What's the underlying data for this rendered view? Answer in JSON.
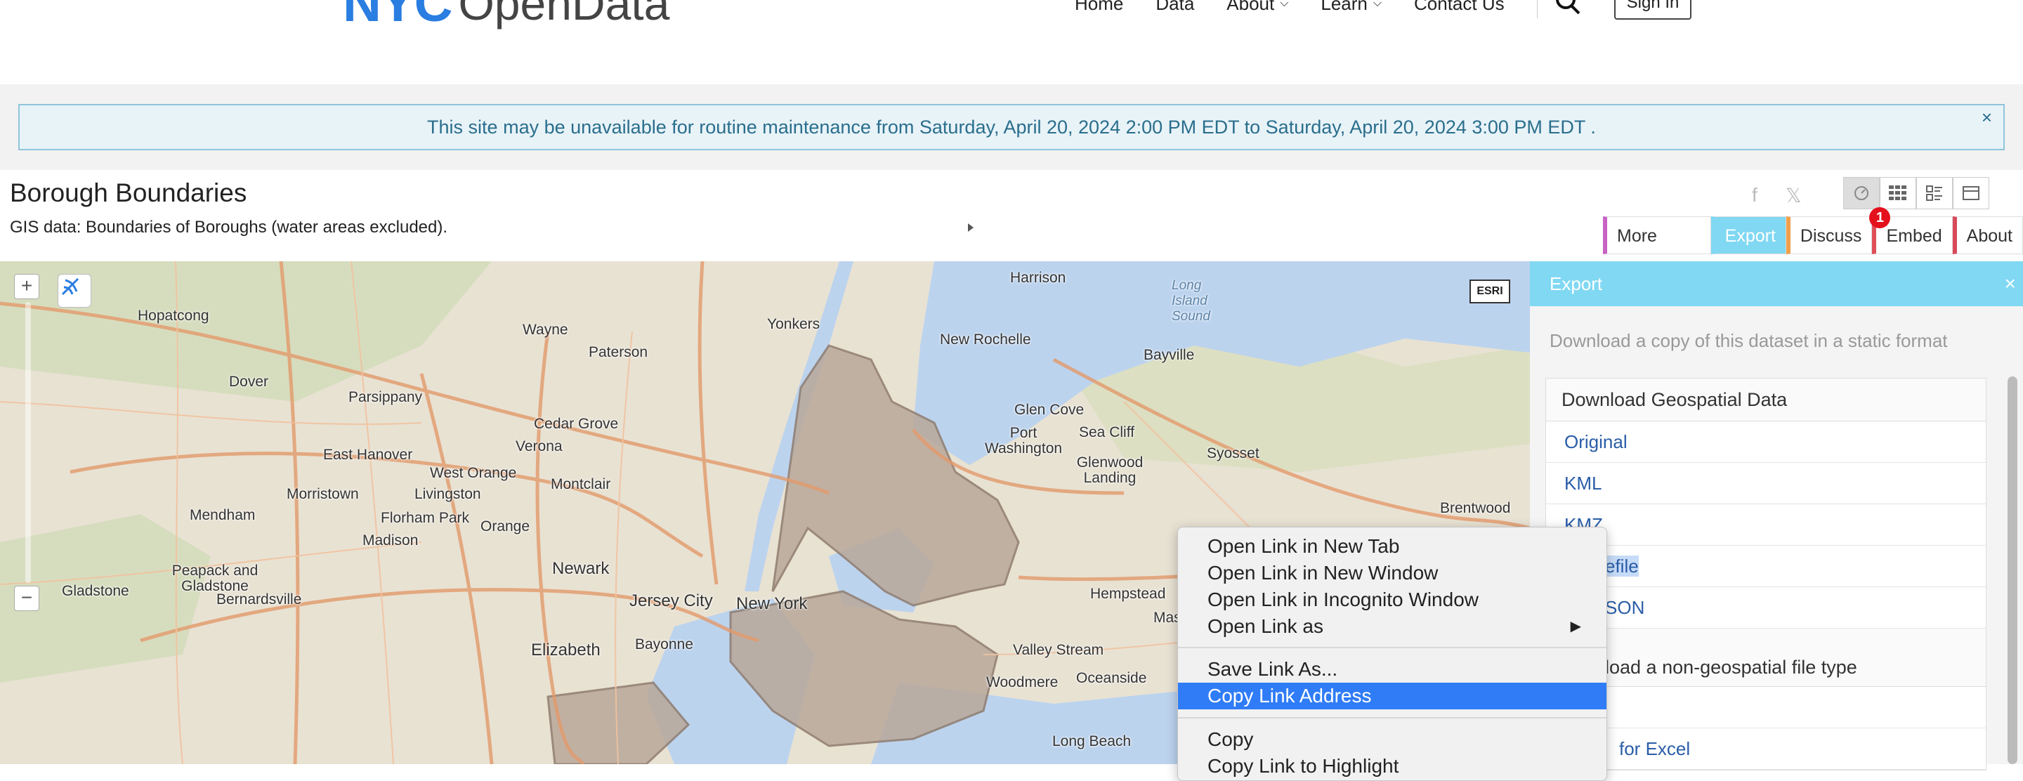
{
  "header": {
    "logo_nyc": "NYC",
    "logo_opendata": "OpenData",
    "nav": [
      {
        "label": "Home",
        "dropdown": false
      },
      {
        "label": "Data",
        "dropdown": false
      },
      {
        "label": "About",
        "dropdown": true
      },
      {
        "label": "Learn",
        "dropdown": true
      },
      {
        "label": "Contact Us",
        "dropdown": false
      }
    ],
    "signin": "Sign In"
  },
  "banner": {
    "text": "This site may be unavailable for routine maintenance from  Saturday, April 20, 2024 2:00 PM EDT  to  Saturday, April 20, 2024 3:00 PM EDT .",
    "close": "×"
  },
  "dataset": {
    "title": "Borough Boundaries",
    "description": "GIS data: Boundaries of Boroughs (water areas excluded)."
  },
  "tabs": [
    {
      "label": "More Views"
    },
    {
      "label": "Export"
    },
    {
      "label": "Discuss"
    },
    {
      "label": "Embed"
    },
    {
      "label": "About"
    }
  ],
  "notification_count": "1",
  "map": {
    "attribution": "ESRI",
    "zoom_in": "+",
    "zoom_out": "−",
    "labels": [
      "Harrison",
      "Hopatcong",
      "Wayne",
      "Yonkers",
      "New Rochelle",
      "Paterson",
      "Bayville",
      "Long Island Sound",
      "Dover",
      "Parsippany",
      "Cedar Grove",
      "Glen Cove",
      "Port Washington",
      "Sea Cliff",
      "Verona",
      "Glenwood Landing",
      "Syosset",
      "East Hanover",
      "West Orange",
      "Montclair",
      "Morristown",
      "Livingston",
      "Florham Park",
      "Orange",
      "Mendham",
      "Madison",
      "Brentwood",
      "Newark",
      "Peapack and Gladstone",
      "Gladstone",
      "Bernardsville",
      "Jersey City",
      "New York",
      "Hempstead",
      "Elizabeth",
      "Bayonne",
      "Valley Stream",
      "Woodmere",
      "Oceanside",
      "Long Beach",
      "Mas"
    ]
  },
  "export_panel": {
    "title": "Export",
    "close": "×",
    "description": "Download a copy of this dataset in a static format",
    "geo_header": "Download Geospatial Data",
    "geo_items": [
      "Original",
      "KML",
      "KMZ",
      "efile",
      "SON"
    ],
    "nongeo_header": "load a non-geospatial file type",
    "nongeo_items": [
      "",
      "for Excel"
    ]
  },
  "context_menu": {
    "items": [
      "Open Link in New Tab",
      "Open Link in New Window",
      "Open Link in Incognito Window",
      "Open Link as",
      "Save Link As...",
      "Copy Link Address",
      "Copy",
      "Copy Link to Highlight"
    ],
    "submenu_arrow": "▶"
  }
}
